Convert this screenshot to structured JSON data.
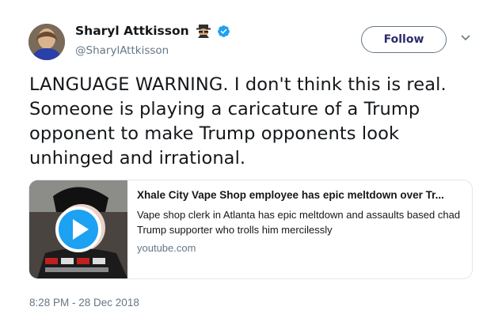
{
  "tweet": {
    "author_name": "Sharyl Attkisson",
    "author_handle": "@SharylAttkisson",
    "follow_label": "Follow",
    "text": "LANGUAGE WARNING. I don't think this is real. Someone is playing a caricature of a Trump opponent to make Trump opponents look unhinged and irrational.",
    "timestamp": "8:28 PM - 28 Dec 2018"
  },
  "card": {
    "title": "Xhale City Vape Shop employee has epic meltdown over Tr...",
    "description": "Vape shop clerk in Atlanta has epic meltdown and assaults based chad Trump supporter who trolls him mercilessly",
    "domain": "youtube.com"
  },
  "icons": {
    "author_badge": "spy-emoji-icon",
    "verified": "verified-badge-icon",
    "more": "chevron-down-icon",
    "play": "play-icon"
  },
  "colors": {
    "verified_blue": "#1da1f2",
    "text_primary": "#14171a",
    "text_secondary": "#657786",
    "card_border": "#e1e8ed"
  }
}
